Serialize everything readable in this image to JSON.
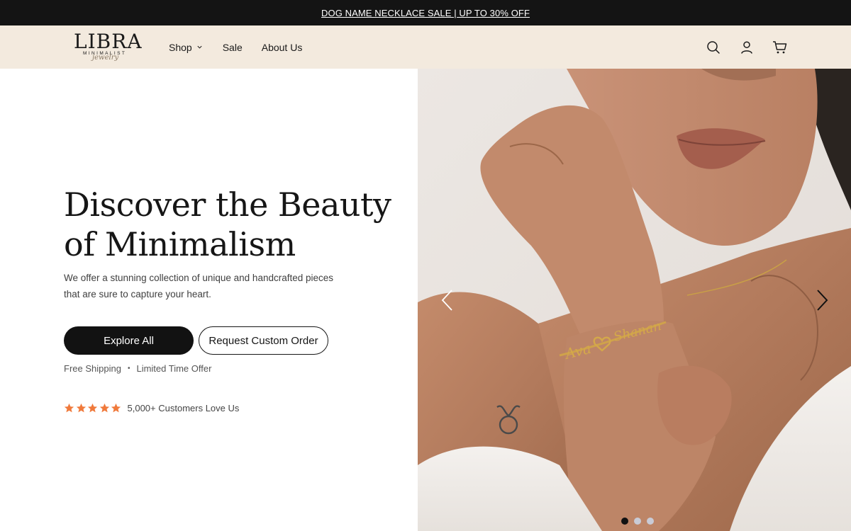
{
  "announcement": {
    "text": "DOG NAME NECKLACE SALE | UP TO 30% OFF"
  },
  "logo": {
    "main": "LIBRA",
    "sub": "MINIMALIST",
    "script": "jewelry"
  },
  "nav": {
    "items": [
      {
        "label": "Shop"
      },
      {
        "label": "Sale"
      },
      {
        "label": "About Us"
      }
    ]
  },
  "header_icons": [
    "search-icon",
    "account-icon",
    "cart-icon"
  ],
  "hero": {
    "title_line1": "Discover the Beauty",
    "title_line2": "of Minimalism",
    "description_line1": "We offer a stunning collection of unique and handcrafted pieces",
    "description_line2": "that are sure to capture your heart.",
    "primary_button": "Explore All",
    "secondary_button": "Request Custom Order",
    "perk1": "Free Shipping",
    "perk_separator": "•",
    "perk2": "Limited Time Offer",
    "rating_stars": 5,
    "reviews_text": "5,000+ Customers Love Us",
    "bracelet_name1": "Ava",
    "bracelet_name2": "Shanan"
  },
  "slider": {
    "slide_count": 3,
    "active_slide": 1
  },
  "colors": {
    "announcement_bg": "#141414",
    "header_bg": "#f3eade",
    "primary_button": "#121212",
    "star": "#f07a3c",
    "dot_inactive": "#c9cbd6"
  }
}
